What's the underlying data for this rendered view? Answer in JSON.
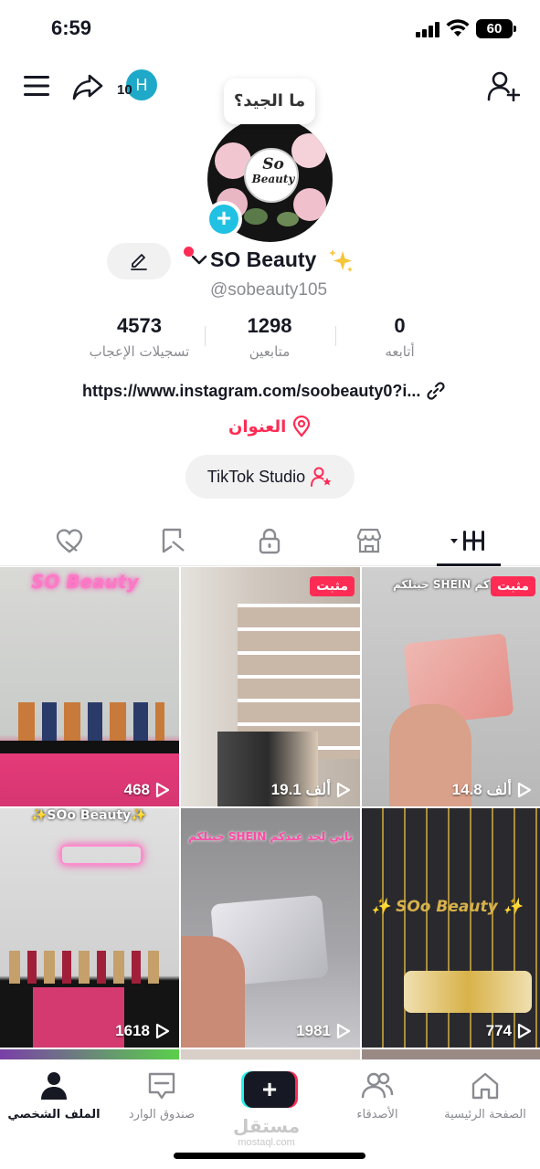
{
  "status_bar": {
    "time": "6:59",
    "battery": "60"
  },
  "header": {
    "story_count": "10",
    "story_initial": "H"
  },
  "profile": {
    "tooltip": "ما الجيد؟",
    "logo_line1": "So",
    "logo_line2": "Beauty",
    "name": "SO Beauty",
    "handle": "@sobeauty105",
    "stats": [
      {
        "value": "4573",
        "label": "تسجيلات الإعجاب"
      },
      {
        "value": "1298",
        "label": "متابعين"
      },
      {
        "value": "0",
        "label": "أتابعه"
      }
    ],
    "bio_link": "https://www.instagram.com/soobeauty0?i...",
    "address": "العنوان",
    "studio_button": "TikTok Studio"
  },
  "tabs": [
    "videos-tab",
    "shop-tab",
    "private-tab",
    "reposts-tab",
    "liked-tab"
  ],
  "videos": [
    {
      "views": "468",
      "caption": "SO Beauty",
      "pinned": false,
      "colors": [
        "#d9d9d6",
        "#e43a78"
      ]
    },
    {
      "views": "19.1 ألف",
      "caption": "",
      "pinned": true,
      "pinned_label": "مثبت",
      "colors": [
        "#cfc6bd",
        "#3a3a3a"
      ]
    },
    {
      "views": "14.8 ألف",
      "caption": "جبتلكم SHEIN لحد عندكم",
      "pinned": true,
      "pinned_label": "مثبت",
      "colors": [
        "#c9c9c9",
        "#e8a6a0"
      ]
    },
    {
      "views": "1618",
      "caption": "✨SOo Beauty✨",
      "pinned": false,
      "colors": [
        "#dcdcdc",
        "#d43a70"
      ]
    },
    {
      "views": "1981",
      "caption": "جبتلكم SHEIN تاني لحد عندكم",
      "pinned": false,
      "colors": [
        "#8d8d8f",
        "#c8c8cc"
      ]
    },
    {
      "views": "774",
      "caption": "✨ SOo Beauty ✨",
      "pinned": false,
      "colors": [
        "#2a2a2e",
        "#d8b24a"
      ]
    }
  ],
  "bottom_nav": [
    {
      "label": "الصفحة الرئيسية"
    },
    {
      "label": "الأصدقاء"
    },
    {
      "label": ""
    },
    {
      "label": "صندوق الوارد"
    },
    {
      "label": "الملف الشخصي"
    }
  ],
  "watermark": {
    "arabic": "مستقل",
    "latin": "mostaql.com"
  },
  "colors": {
    "accent": "#fe2c55",
    "cyan": "#25f4ee",
    "text": "#161823",
    "muted": "#8a8b91"
  }
}
